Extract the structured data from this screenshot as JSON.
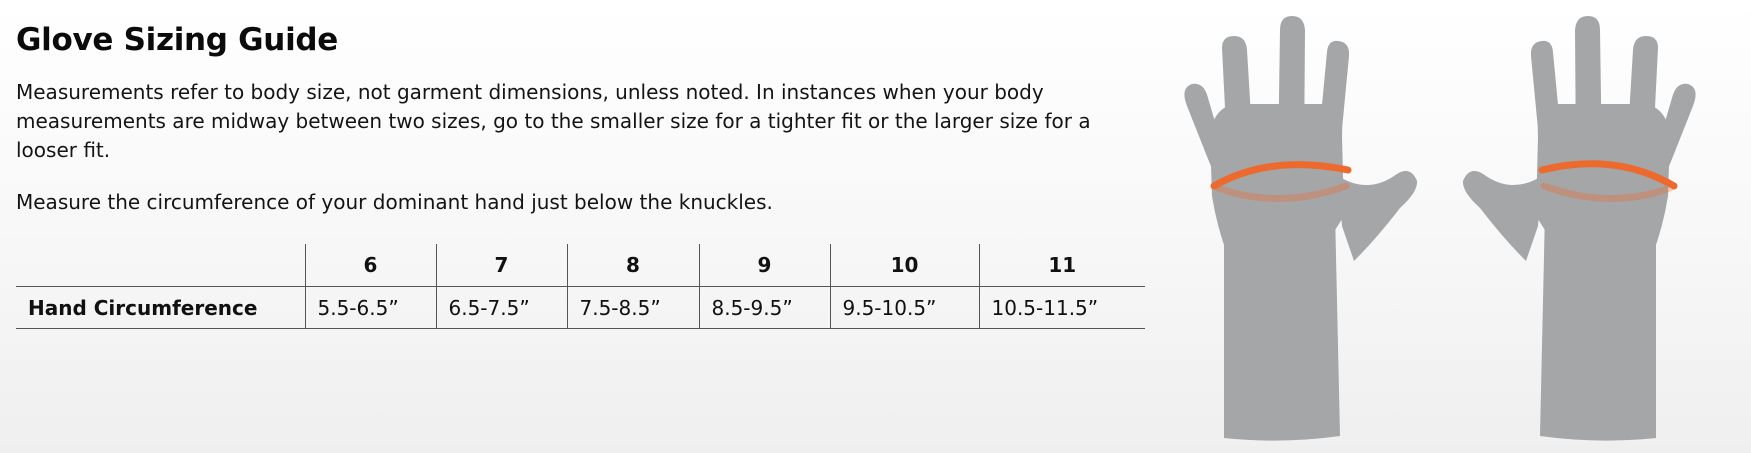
{
  "title": "Glove Sizing Guide",
  "intro": "Measurements refer to body size, not garment dimensions, unless noted. In instances when your body measurements are midway between two sizes, go to the smaller size for a tighter fit or the larger size for a looser fit.",
  "instruction": "Measure the circumference of your dominant hand just below the knuckles.",
  "table": {
    "sizes": [
      "6",
      "7",
      "8",
      "9",
      "10",
      "11"
    ],
    "row_label": "Hand Circumference",
    "values": [
      "5.5-6.5”",
      "6.5-7.5”",
      "7.5-8.5”",
      "8.5-9.5”",
      "9.5-10.5”",
      "10.5-11.5”"
    ]
  },
  "illustration": {
    "hand_color": "#a5a6a8",
    "band_color": "#ec6a2e"
  }
}
